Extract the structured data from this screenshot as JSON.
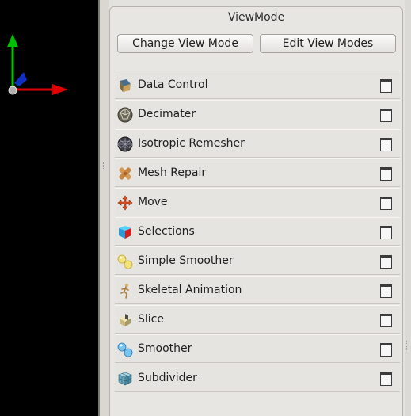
{
  "viewport": {
    "axes_icon": "xyz-axes-icon"
  },
  "panel": {
    "title": "ViewMode",
    "change_label": "Change View Mode",
    "edit_label": "Edit View Modes"
  },
  "toolboxes": [
    {
      "label": "Data Control",
      "icon": "data-control-icon"
    },
    {
      "label": "Decimater",
      "icon": "decimater-icon"
    },
    {
      "label": "Isotropic Remesher",
      "icon": "remesher-icon"
    },
    {
      "label": "Mesh Repair",
      "icon": "mesh-repair-icon"
    },
    {
      "label": "Move",
      "icon": "move-icon"
    },
    {
      "label": "Selections",
      "icon": "selections-icon"
    },
    {
      "label": "Simple Smoother",
      "icon": "simple-smoother-icon"
    },
    {
      "label": "Skeletal Animation",
      "icon": "skeletal-animation-icon"
    },
    {
      "label": "Slice",
      "icon": "slice-icon"
    },
    {
      "label": "Smoother",
      "icon": "smoother-icon"
    },
    {
      "label": "Subdivider",
      "icon": "subdivider-icon"
    }
  ],
  "colors": {
    "axis_x": "#e00000",
    "axis_y": "#00c000",
    "axis_z": "#1030c0",
    "viewport_bg": "#000000",
    "panel_bg": "#e8e6e3"
  }
}
